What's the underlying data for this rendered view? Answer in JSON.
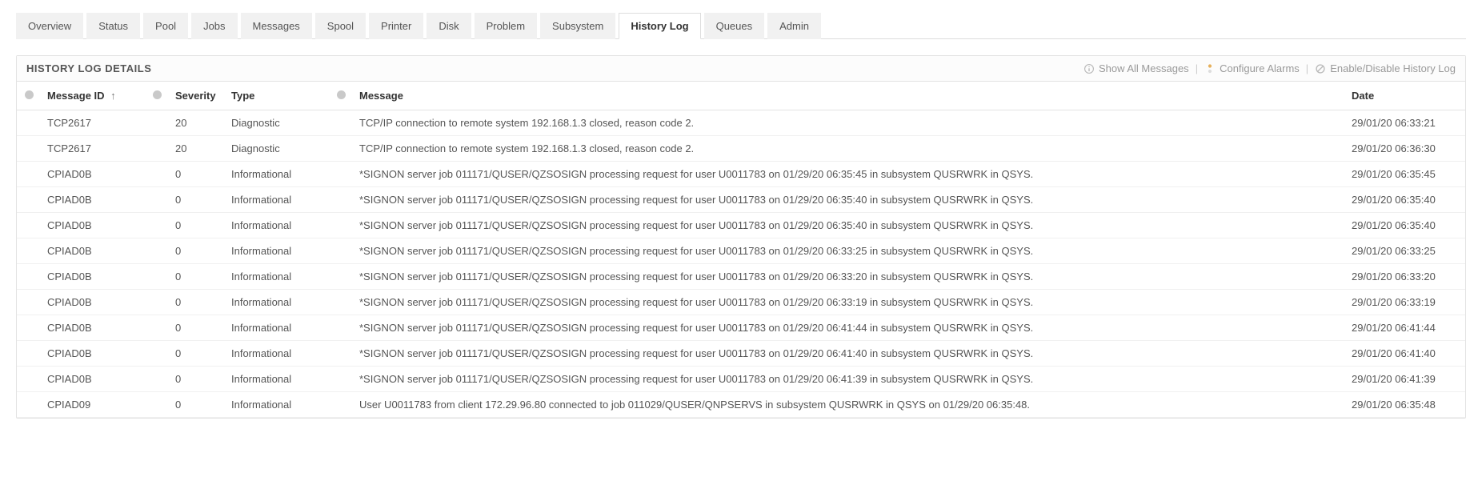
{
  "tabs": [
    {
      "label": "Overview",
      "active": false
    },
    {
      "label": "Status",
      "active": false
    },
    {
      "label": "Pool",
      "active": false
    },
    {
      "label": "Jobs",
      "active": false
    },
    {
      "label": "Messages",
      "active": false
    },
    {
      "label": "Spool",
      "active": false
    },
    {
      "label": "Printer",
      "active": false
    },
    {
      "label": "Disk",
      "active": false
    },
    {
      "label": "Problem",
      "active": false
    },
    {
      "label": "Subsystem",
      "active": false
    },
    {
      "label": "History Log",
      "active": true
    },
    {
      "label": "Queues",
      "active": false
    },
    {
      "label": "Admin",
      "active": false
    }
  ],
  "panel": {
    "title": "HISTORY LOG DETAILS",
    "actions": {
      "show_all": "Show All Messages",
      "configure_alarms": "Configure Alarms",
      "enable_disable": "Enable/Disable History Log"
    }
  },
  "table": {
    "headers": {
      "message_id": "Message ID",
      "sort_indicator": "↑",
      "severity": "Severity",
      "type": "Type",
      "message": "Message",
      "date": "Date"
    },
    "rows": [
      {
        "message_id": "TCP2617",
        "severity": "20",
        "type": "Diagnostic",
        "message": "TCP/IP connection to remote system 192.168.1.3 closed, reason code 2.",
        "date": "29/01/20 06:33:21"
      },
      {
        "message_id": "TCP2617",
        "severity": "20",
        "type": "Diagnostic",
        "message": "TCP/IP connection to remote system 192.168.1.3 closed, reason code 2.",
        "date": "29/01/20 06:36:30"
      },
      {
        "message_id": "CPIAD0B",
        "severity": "0",
        "type": "Informational",
        "message": "*SIGNON server job 011171/QUSER/QZSOSIGN processing request for user U0011783 on 01/29/20 06:35:45 in subsystem QUSRWRK in QSYS.",
        "date": "29/01/20 06:35:45"
      },
      {
        "message_id": "CPIAD0B",
        "severity": "0",
        "type": "Informational",
        "message": "*SIGNON server job 011171/QUSER/QZSOSIGN processing request for user U0011783 on 01/29/20 06:35:40 in subsystem QUSRWRK in QSYS.",
        "date": "29/01/20 06:35:40"
      },
      {
        "message_id": "CPIAD0B",
        "severity": "0",
        "type": "Informational",
        "message": "*SIGNON server job 011171/QUSER/QZSOSIGN processing request for user U0011783 on 01/29/20 06:35:40 in subsystem QUSRWRK in QSYS.",
        "date": "29/01/20 06:35:40"
      },
      {
        "message_id": "CPIAD0B",
        "severity": "0",
        "type": "Informational",
        "message": "*SIGNON server job 011171/QUSER/QZSOSIGN processing request for user U0011783 on 01/29/20 06:33:25 in subsystem QUSRWRK in QSYS.",
        "date": "29/01/20 06:33:25"
      },
      {
        "message_id": "CPIAD0B",
        "severity": "0",
        "type": "Informational",
        "message": "*SIGNON server job 011171/QUSER/QZSOSIGN processing request for user U0011783 on 01/29/20 06:33:20 in subsystem QUSRWRK in QSYS.",
        "date": "29/01/20 06:33:20"
      },
      {
        "message_id": "CPIAD0B",
        "severity": "0",
        "type": "Informational",
        "message": "*SIGNON server job 011171/QUSER/QZSOSIGN processing request for user U0011783 on 01/29/20 06:33:19 in subsystem QUSRWRK in QSYS.",
        "date": "29/01/20 06:33:19"
      },
      {
        "message_id": "CPIAD0B",
        "severity": "0",
        "type": "Informational",
        "message": "*SIGNON server job 011171/QUSER/QZSOSIGN processing request for user U0011783 on 01/29/20 06:41:44 in subsystem QUSRWRK in QSYS.",
        "date": "29/01/20 06:41:44"
      },
      {
        "message_id": "CPIAD0B",
        "severity": "0",
        "type": "Informational",
        "message": "*SIGNON server job 011171/QUSER/QZSOSIGN processing request for user U0011783 on 01/29/20 06:41:40 in subsystem QUSRWRK in QSYS.",
        "date": "29/01/20 06:41:40"
      },
      {
        "message_id": "CPIAD0B",
        "severity": "0",
        "type": "Informational",
        "message": "*SIGNON server job 011171/QUSER/QZSOSIGN processing request for user U0011783 on 01/29/20 06:41:39 in subsystem QUSRWRK in QSYS.",
        "date": "29/01/20 06:41:39"
      },
      {
        "message_id": "CPIAD09",
        "severity": "0",
        "type": "Informational",
        "message": "User U0011783 from client 172.29.96.80 connected to job 011029/QUSER/QNPSERVS in subsystem QUSRWRK in QSYS on 01/29/20 06:35:48.",
        "date": "29/01/20 06:35:48"
      }
    ]
  }
}
